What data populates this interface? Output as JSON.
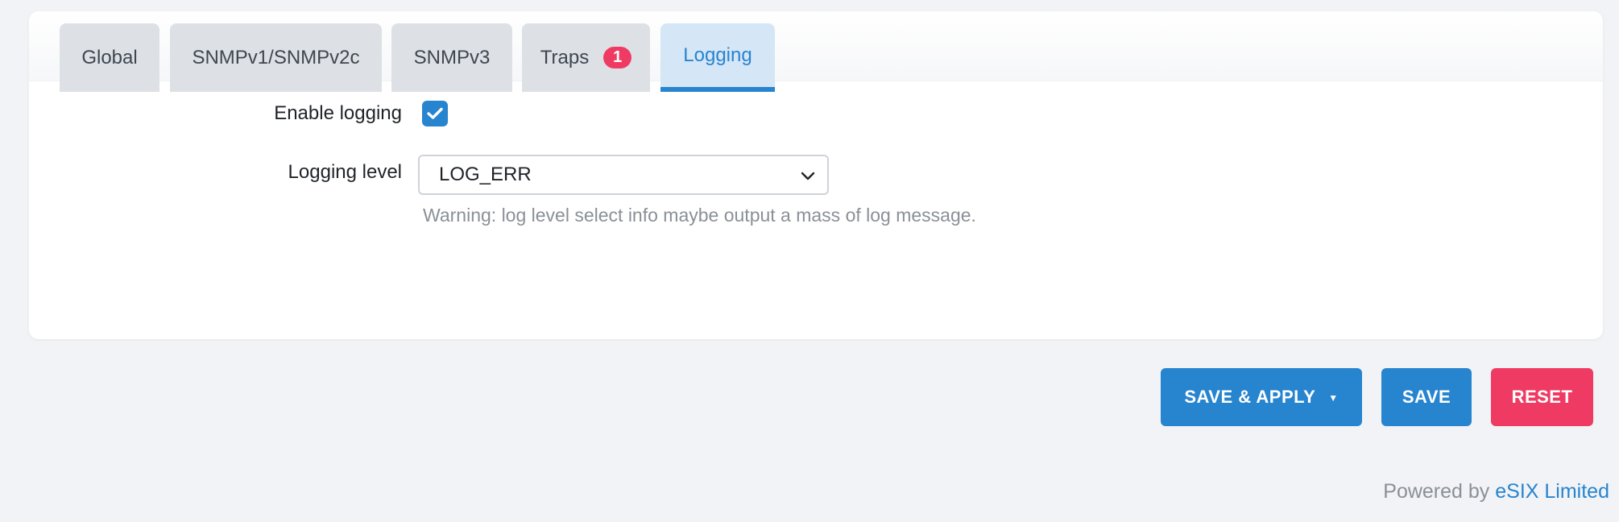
{
  "tabs": [
    {
      "label": "Global"
    },
    {
      "label": "SNMPv1/SNMPv2c"
    },
    {
      "label": "SNMPv3"
    },
    {
      "label": "Traps",
      "badge": "1"
    },
    {
      "label": "Logging",
      "active": true
    }
  ],
  "form": {
    "enable_logging": {
      "label": "Enable logging",
      "checked": true
    },
    "logging_level": {
      "label": "Logging level",
      "value": "LOG_ERR",
      "hint": "Warning: log level select info maybe output a mass of log message."
    }
  },
  "actions": {
    "save_apply": "SAVE & APPLY",
    "save": "SAVE",
    "reset": "RESET"
  },
  "footer": {
    "powered_by": "Powered by",
    "vendor": "eSIX Limited"
  },
  "colors": {
    "accent": "#2784cf",
    "danger": "#ef3b63",
    "tab_bg": "#dde1e5",
    "tab_active_bg": "#d5e6f6",
    "page_bg": "#f2f3f6"
  }
}
